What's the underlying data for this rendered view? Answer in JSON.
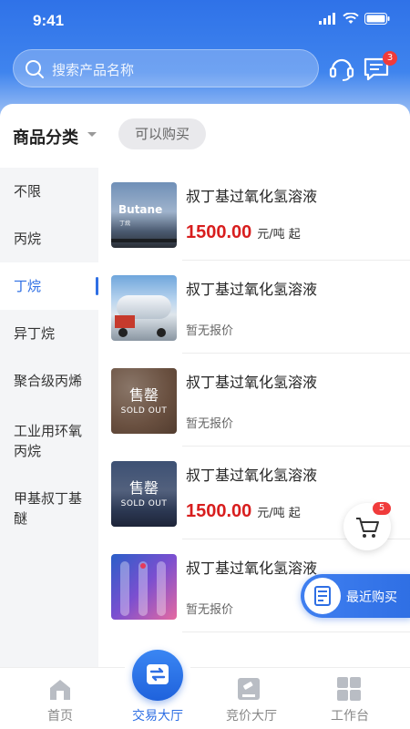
{
  "status_bar": {
    "time": "9:41"
  },
  "search": {
    "placeholder": "搜索产品名称",
    "message_badge": "3"
  },
  "category": {
    "title": "商品分类",
    "filter_chip": "可以购买"
  },
  "sidebar": {
    "items": [
      {
        "label": "不限"
      },
      {
        "label": "丙烷"
      },
      {
        "label": "丁烷",
        "active": true
      },
      {
        "label": "异丁烷"
      },
      {
        "label": "聚合级丙烯"
      },
      {
        "label": "工业用环氧丙烷"
      },
      {
        "label": "甲基叔丁基醚"
      }
    ]
  },
  "products": [
    {
      "name": "叔丁基过氧化氢溶液",
      "price": "1500.00",
      "unit": "元/吨 起",
      "thumb_text": "Butane",
      "thumb_sub": "丁烷"
    },
    {
      "name": "叔丁基过氧化氢溶液",
      "no_price": "暂无报价"
    },
    {
      "name": "叔丁基过氧化氢溶液",
      "no_price": "暂无报价",
      "soldout": "售罄",
      "soldout_en": "SOLD OUT"
    },
    {
      "name": "叔丁基过氧化氢溶液",
      "price": "1500.00",
      "unit": "元/吨 起",
      "soldout": "售罄",
      "soldout_en": "SOLD OUT"
    },
    {
      "name": "叔丁基过氧化氢溶液",
      "no_price": "暂无报价"
    }
  ],
  "cart": {
    "badge": "5"
  },
  "recent_purchase": {
    "label": "最近购买"
  },
  "tabbar": {
    "tabs": [
      {
        "label": "首页"
      },
      {
        "label": "交易大厅",
        "active": true
      },
      {
        "label": "竞价大厅"
      },
      {
        "label": "工作台"
      }
    ]
  },
  "colors": {
    "primary": "#2f6fe4",
    "price": "#d81e1e",
    "badge": "#f03b3b"
  }
}
